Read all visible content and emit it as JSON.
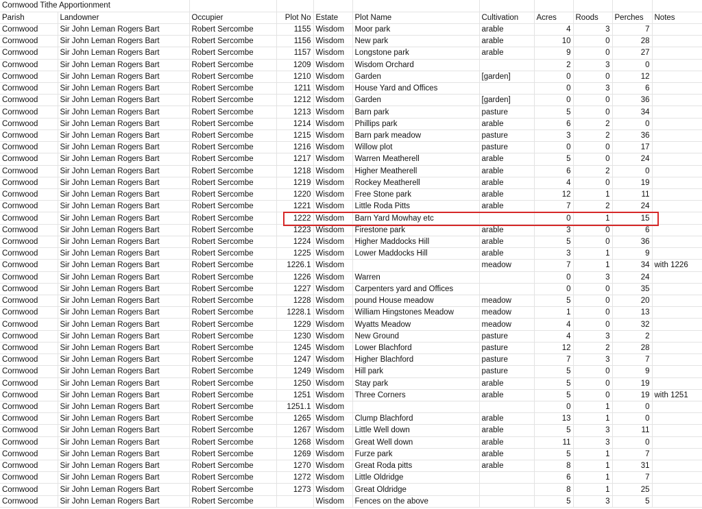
{
  "title": "Cornwood Tithe Apportionment",
  "highlight_color": "#d62828",
  "highlighted_plot": "1222",
  "headers": [
    "Parish",
    "Landowner",
    "Occupier",
    "Plot No",
    "Estate",
    "Plot Name",
    "Cultivation",
    "Acres",
    "Roods",
    "Perches",
    "Notes"
  ],
  "rows": [
    [
      "Cornwood",
      "Sir John Leman Rogers Bart",
      "Robert Sercombe",
      "1155",
      "Wisdom",
      "Moor park",
      "arable",
      "4",
      "3",
      "7",
      ""
    ],
    [
      "Cornwood",
      "Sir John Leman Rogers Bart",
      "Robert Sercombe",
      "1156",
      "Wisdom",
      "New park",
      "arable",
      "10",
      "0",
      "28",
      ""
    ],
    [
      "Cornwood",
      "Sir John Leman Rogers Bart",
      "Robert Sercombe",
      "1157",
      "Wisdom",
      "Longstone park",
      "arable",
      "9",
      "0",
      "27",
      ""
    ],
    [
      "Cornwood",
      "Sir John Leman Rogers Bart",
      "Robert Sercombe",
      "1209",
      "Wisdom",
      "Wisdom Orchard",
      "",
      "2",
      "3",
      "0",
      ""
    ],
    [
      "Cornwood",
      "Sir John Leman Rogers Bart",
      "Robert Sercombe",
      "1210",
      "Wisdom",
      "Garden",
      "[garden]",
      "0",
      "0",
      "12",
      ""
    ],
    [
      "Cornwood",
      "Sir John Leman Rogers Bart",
      "Robert Sercombe",
      "1211",
      "Wisdom",
      "House Yard and Offices",
      "",
      "0",
      "3",
      "6",
      ""
    ],
    [
      "Cornwood",
      "Sir John Leman Rogers Bart",
      "Robert Sercombe",
      "1212",
      "Wisdom",
      "Garden",
      "[garden]",
      "0",
      "0",
      "36",
      ""
    ],
    [
      "Cornwood",
      "Sir John Leman Rogers Bart",
      "Robert Sercombe",
      "1213",
      "Wisdom",
      "Barn park",
      "pasture",
      "5",
      "0",
      "34",
      ""
    ],
    [
      "Cornwood",
      "Sir John Leman Rogers Bart",
      "Robert Sercombe",
      "1214",
      "Wisdom",
      "Phillips park",
      "arable",
      "6",
      "2",
      "0",
      ""
    ],
    [
      "Cornwood",
      "Sir John Leman Rogers Bart",
      "Robert Sercombe",
      "1215",
      "Wisdom",
      "Barn park meadow",
      "pasture",
      "3",
      "2",
      "36",
      ""
    ],
    [
      "Cornwood",
      "Sir John Leman Rogers Bart",
      "Robert Sercombe",
      "1216",
      "Wisdom",
      "Willow plot",
      "pasture",
      "0",
      "0",
      "17",
      ""
    ],
    [
      "Cornwood",
      "Sir John Leman Rogers Bart",
      "Robert Sercombe",
      "1217",
      "Wisdom",
      "Warren Meatherell",
      "arable",
      "5",
      "0",
      "24",
      ""
    ],
    [
      "Cornwood",
      "Sir John Leman Rogers Bart",
      "Robert Sercombe",
      "1218",
      "Wisdom",
      "Higher Meatherell",
      "arable",
      "6",
      "2",
      "0",
      ""
    ],
    [
      "Cornwood",
      "Sir John Leman Rogers Bart",
      "Robert Sercombe",
      "1219",
      "Wisdom",
      "Rockey Meatherell",
      "arable",
      "4",
      "0",
      "19",
      ""
    ],
    [
      "Cornwood",
      "Sir John Leman Rogers Bart",
      "Robert Sercombe",
      "1220",
      "Wisdom",
      "Free Stone park",
      "arable",
      "12",
      "1",
      "11",
      ""
    ],
    [
      "Cornwood",
      "Sir John Leman Rogers Bart",
      "Robert Sercombe",
      "1221",
      "Wisdom",
      "Little Roda Pitts",
      "arable",
      "7",
      "2",
      "24",
      ""
    ],
    [
      "Cornwood",
      "Sir John Leman Rogers Bart",
      "Robert Sercombe",
      "1222",
      "Wisdom",
      "Barn Yard Mowhay etc",
      "",
      "0",
      "1",
      "15",
      ""
    ],
    [
      "Cornwood",
      "Sir John Leman Rogers Bart",
      "Robert Sercombe",
      "1223",
      "Wisdom",
      "Firestone park",
      "arable",
      "3",
      "0",
      "6",
      ""
    ],
    [
      "Cornwood",
      "Sir John Leman Rogers Bart",
      "Robert Sercombe",
      "1224",
      "Wisdom",
      "Higher Maddocks Hill",
      "arable",
      "5",
      "0",
      "36",
      ""
    ],
    [
      "Cornwood",
      "Sir John Leman Rogers Bart",
      "Robert Sercombe",
      "1225",
      "Wisdom",
      "Lower Maddocks Hill",
      "arable",
      "3",
      "1",
      "9",
      ""
    ],
    [
      "Cornwood",
      "Sir John Leman Rogers Bart",
      "Robert Sercombe",
      "1226.1",
      "Wisdom",
      "",
      "meadow",
      "7",
      "1",
      "34",
      "with 1226"
    ],
    [
      "Cornwood",
      "Sir John Leman Rogers Bart",
      "Robert Sercombe",
      "1226",
      "Wisdom",
      "Warren",
      "",
      "0",
      "3",
      "24",
      ""
    ],
    [
      "Cornwood",
      "Sir John Leman Rogers Bart",
      "Robert Sercombe",
      "1227",
      "Wisdom",
      "Carpenters yard and Offices",
      "",
      "0",
      "0",
      "35",
      ""
    ],
    [
      "Cornwood",
      "Sir John Leman Rogers Bart",
      "Robert Sercombe",
      "1228",
      "Wisdom",
      "pound House meadow",
      "meadow",
      "5",
      "0",
      "20",
      ""
    ],
    [
      "Cornwood",
      "Sir John Leman Rogers Bart",
      "Robert Sercombe",
      "1228.1",
      "Wisdom",
      "William Hingstones Meadow",
      "meadow",
      "1",
      "0",
      "13",
      ""
    ],
    [
      "Cornwood",
      "Sir John Leman Rogers Bart",
      "Robert Sercombe",
      "1229",
      "Wisdom",
      "Wyatts Meadow",
      "meadow",
      "4",
      "0",
      "32",
      ""
    ],
    [
      "Cornwood",
      "Sir John Leman Rogers Bart",
      "Robert Sercombe",
      "1230",
      "Wisdom",
      "New Ground",
      "pasture",
      "4",
      "3",
      "2",
      ""
    ],
    [
      "Cornwood",
      "Sir John Leman Rogers Bart",
      "Robert Sercombe",
      "1245",
      "Wisdom",
      "Lower Blachford",
      "pasture",
      "12",
      "2",
      "28",
      ""
    ],
    [
      "Cornwood",
      "Sir John Leman Rogers Bart",
      "Robert Sercombe",
      "1247",
      "Wisdom",
      "Higher Blachford",
      "pasture",
      "7",
      "3",
      "7",
      ""
    ],
    [
      "Cornwood",
      "Sir John Leman Rogers Bart",
      "Robert Sercombe",
      "1249",
      "Wisdom",
      "Hill park",
      "pasture",
      "5",
      "0",
      "9",
      ""
    ],
    [
      "Cornwood",
      "Sir John Leman Rogers Bart",
      "Robert Sercombe",
      "1250",
      "Wisdom",
      "Stay park",
      "arable",
      "5",
      "0",
      "19",
      ""
    ],
    [
      "Cornwood",
      "Sir John Leman Rogers Bart",
      "Robert Sercombe",
      "1251",
      "Wisdom",
      "Three Corners",
      "arable",
      "5",
      "0",
      "19",
      "with 1251"
    ],
    [
      "Cornwood",
      "Sir John Leman Rogers Bart",
      "Robert Sercombe",
      "1251.1",
      "Wisdom",
      "",
      "",
      "0",
      "1",
      "0",
      ""
    ],
    [
      "Cornwood",
      "Sir John Leman Rogers Bart",
      "Robert Sercombe",
      "1265",
      "Wisdom",
      "Clump Blachford",
      "arable",
      "13",
      "1",
      "0",
      ""
    ],
    [
      "Cornwood",
      "Sir John Leman Rogers Bart",
      "Robert Sercombe",
      "1267",
      "Wisdom",
      "Little Well down",
      "arable",
      "5",
      "3",
      "11",
      ""
    ],
    [
      "Cornwood",
      "Sir John Leman Rogers Bart",
      "Robert Sercombe",
      "1268",
      "Wisdom",
      "Great Well down",
      "arable",
      "11",
      "3",
      "0",
      ""
    ],
    [
      "Cornwood",
      "Sir John Leman Rogers Bart",
      "Robert Sercombe",
      "1269",
      "Wisdom",
      "Furze park",
      "arable",
      "5",
      "1",
      "7",
      ""
    ],
    [
      "Cornwood",
      "Sir John Leman Rogers Bart",
      "Robert Sercombe",
      "1270",
      "Wisdom",
      "Great Roda pitts",
      "arable",
      "8",
      "1",
      "31",
      ""
    ],
    [
      "Cornwood",
      "Sir John Leman Rogers Bart",
      "Robert Sercombe",
      "1272",
      "Wisdom",
      "Little Oldridge",
      "",
      "6",
      "1",
      "7",
      ""
    ],
    [
      "Cornwood",
      "Sir John Leman Rogers Bart",
      "Robert Sercombe",
      "1273",
      "Wisdom",
      "Great Oldridge",
      "",
      "8",
      "1",
      "25",
      ""
    ],
    [
      "Cornwood",
      "Sir John Leman Rogers Bart",
      "Robert Sercombe",
      "",
      "Wisdom",
      "Fences on the above",
      "",
      "5",
      "3",
      "5",
      ""
    ]
  ]
}
